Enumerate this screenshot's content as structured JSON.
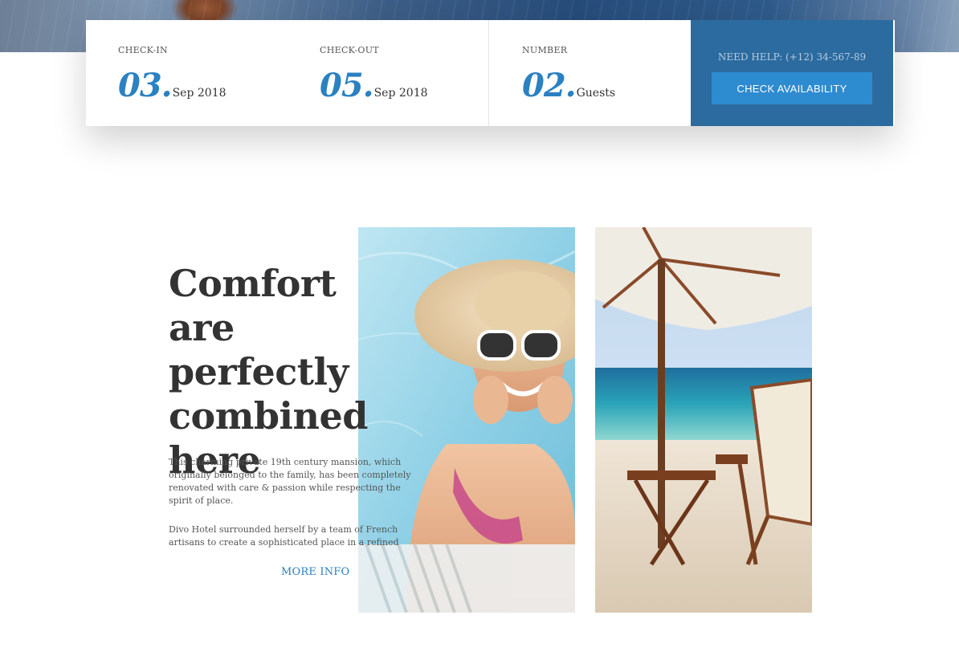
{
  "booking": {
    "checkin": {
      "label": "CHECK-IN",
      "number": "03.",
      "suffix": "Sep 2018"
    },
    "checkout": {
      "label": "CHECK-OUT",
      "number": "05.",
      "suffix": "Sep 2018"
    },
    "guests": {
      "label": "NUMBER",
      "number": "02.",
      "suffix": "Guests"
    },
    "help_text": "NEED HELP: (+12) 34-567-89",
    "check_button_label": "CHECK AVAILABILITY"
  },
  "about": {
    "heading": "Comfort are perfectly combined here",
    "paragraph1": "This charming private 19th century mansion, which originally belonged to the family, has been completely renovated with care & passion while respecting the spirit of place.",
    "paragraph2": "Divo Hotel surrounded herself by a team of French artisans to create a sophisticated place in a refined",
    "more_info_label": "MORE INFO"
  },
  "colors": {
    "accent": "#2b81c1",
    "help_panel": "#2b6b9f",
    "button": "#2d8bd0"
  }
}
